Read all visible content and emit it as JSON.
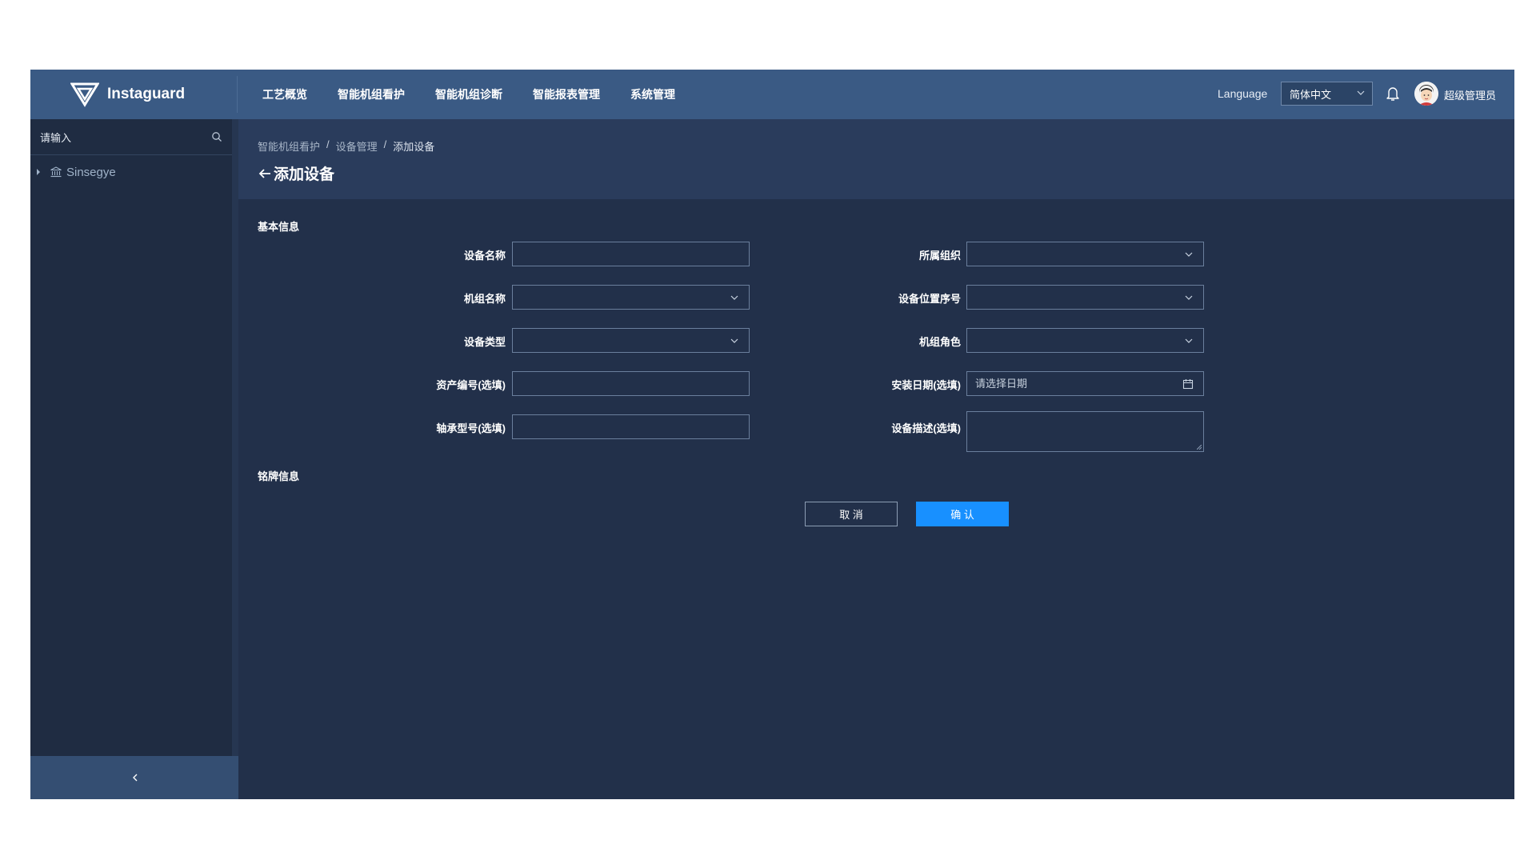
{
  "brand": {
    "name": "Instaguard"
  },
  "nav": {
    "items": [
      {
        "label": "工艺概览"
      },
      {
        "label": "智能机组看护"
      },
      {
        "label": "智能机组诊断"
      },
      {
        "label": "智能报表管理"
      },
      {
        "label": "系统管理"
      }
    ]
  },
  "header": {
    "language_label": "Language",
    "language_value": "简体中文",
    "user_name": "超级管理员"
  },
  "sidebar": {
    "search_placeholder": "请输入",
    "tree": [
      {
        "label": "Sinsegye"
      }
    ]
  },
  "breadcrumb": [
    "智能机组看护",
    "设备管理",
    "添加设备"
  ],
  "page": {
    "title": "添加设备"
  },
  "form": {
    "basic_section": "基本信息",
    "nameplate_section": "铭牌信息",
    "device_name": {
      "label": "设备名称",
      "value": ""
    },
    "org": {
      "label": "所属组织",
      "value": ""
    },
    "unit_name": {
      "label": "机组名称",
      "value": ""
    },
    "position_no": {
      "label": "设备位置序号",
      "value": ""
    },
    "device_type": {
      "label": "设备类型",
      "value": ""
    },
    "unit_role": {
      "label": "机组角色",
      "value": ""
    },
    "asset_no": {
      "label": "资产编号(选填)",
      "value": ""
    },
    "install_date": {
      "label": "安装日期(选填)",
      "placeholder": "请选择日期"
    },
    "bearing_model": {
      "label": "轴承型号(选填)",
      "value": ""
    },
    "description": {
      "label": "设备描述(选填)",
      "value": ""
    }
  },
  "actions": {
    "cancel": "取 消",
    "confirm": "确 认"
  },
  "colors": {
    "topbar": "#3a5a84",
    "content_bg": "#22304a",
    "primary": "#1890ff"
  },
  "icons": [
    "logo-icon",
    "chevron-down-icon",
    "bell-icon",
    "avatar",
    "search-icon",
    "bank-icon",
    "back-arrow-icon",
    "calendar-icon",
    "collapse-left-icon"
  ]
}
